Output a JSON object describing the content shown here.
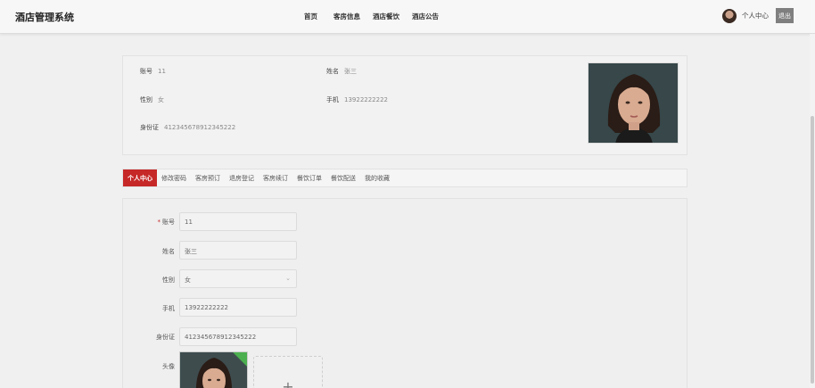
{
  "app": {
    "title": "酒店管理系统"
  },
  "nav": {
    "items": [
      "首页",
      "客房信息",
      "酒店餐饮",
      "酒店公告"
    ]
  },
  "user": {
    "label": "个人中心",
    "logout_label": "退出"
  },
  "profile": {
    "fields": [
      {
        "label": "账号",
        "value": "11"
      },
      {
        "label": "姓名",
        "value": "张三"
      },
      {
        "label": "性别",
        "value": "女"
      },
      {
        "label": "手机",
        "value": "13922222222"
      },
      {
        "label": "身份证",
        "value": "412345678912345222"
      }
    ]
  },
  "tabs": [
    "个人中心",
    "修改密码",
    "客房预订",
    "退房登记",
    "客房续订",
    "餐饮订单",
    "餐饮配送",
    "我的收藏"
  ],
  "active_tab_index": 0,
  "form": {
    "account": {
      "label": "账号",
      "required_mark": "*",
      "value": "11"
    },
    "name": {
      "label": "姓名",
      "value": "张三"
    },
    "gender": {
      "label": "性别",
      "value": "女"
    },
    "phone": {
      "label": "手机",
      "value": "13922222222"
    },
    "idcard": {
      "label": "身份证",
      "value": "412345678912345222"
    },
    "avatar": {
      "label": "头像",
      "add_glyph": "+"
    }
  },
  "colors": {
    "accent": "#c62828",
    "logout_bg": "#7f7f7f",
    "upload_badge": "#4caf50"
  },
  "icons": {
    "select_arrow": "chevron-down-icon",
    "upload_add": "plus-icon"
  }
}
